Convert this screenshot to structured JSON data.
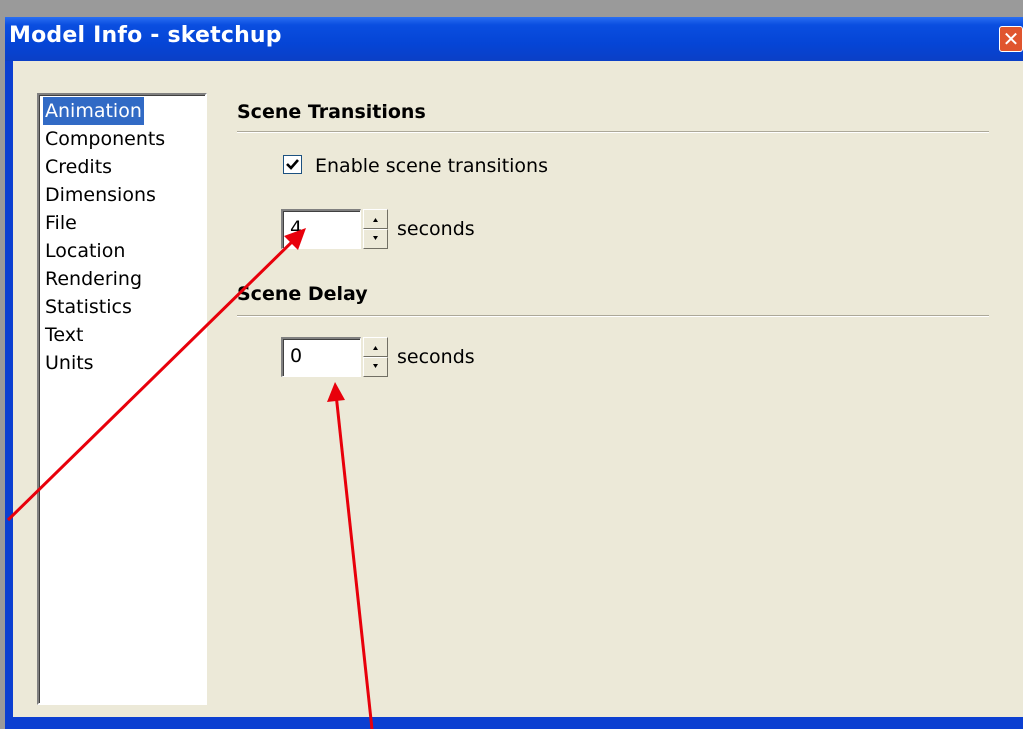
{
  "window": {
    "title": "Model Info - sketchup",
    "close_glyph": "✕"
  },
  "sidebar": {
    "items": [
      {
        "label": "Animation",
        "selected": true
      },
      {
        "label": "Components",
        "selected": false
      },
      {
        "label": "Credits",
        "selected": false
      },
      {
        "label": "Dimensions",
        "selected": false
      },
      {
        "label": "File",
        "selected": false
      },
      {
        "label": "Location",
        "selected": false
      },
      {
        "label": "Rendering",
        "selected": false
      },
      {
        "label": "Statistics",
        "selected": false
      },
      {
        "label": "Text",
        "selected": false
      },
      {
        "label": "Units",
        "selected": false
      }
    ]
  },
  "scene_transitions": {
    "title": "Scene Transitions",
    "enable_label": "Enable scene transitions",
    "enable_checked": true,
    "seconds_value": "4",
    "seconds_label": "seconds"
  },
  "scene_delay": {
    "title": "Scene Delay",
    "seconds_value": "0",
    "seconds_label": "seconds"
  },
  "colors": {
    "titlebar": "#0545d6",
    "selection": "#316ac5",
    "annotation_arrow": "#e8000b"
  },
  "icons": {
    "close": "close-icon",
    "check": "checkmark-icon",
    "spin_up": "spin-up-icon",
    "spin_down": "spin-down-icon"
  }
}
